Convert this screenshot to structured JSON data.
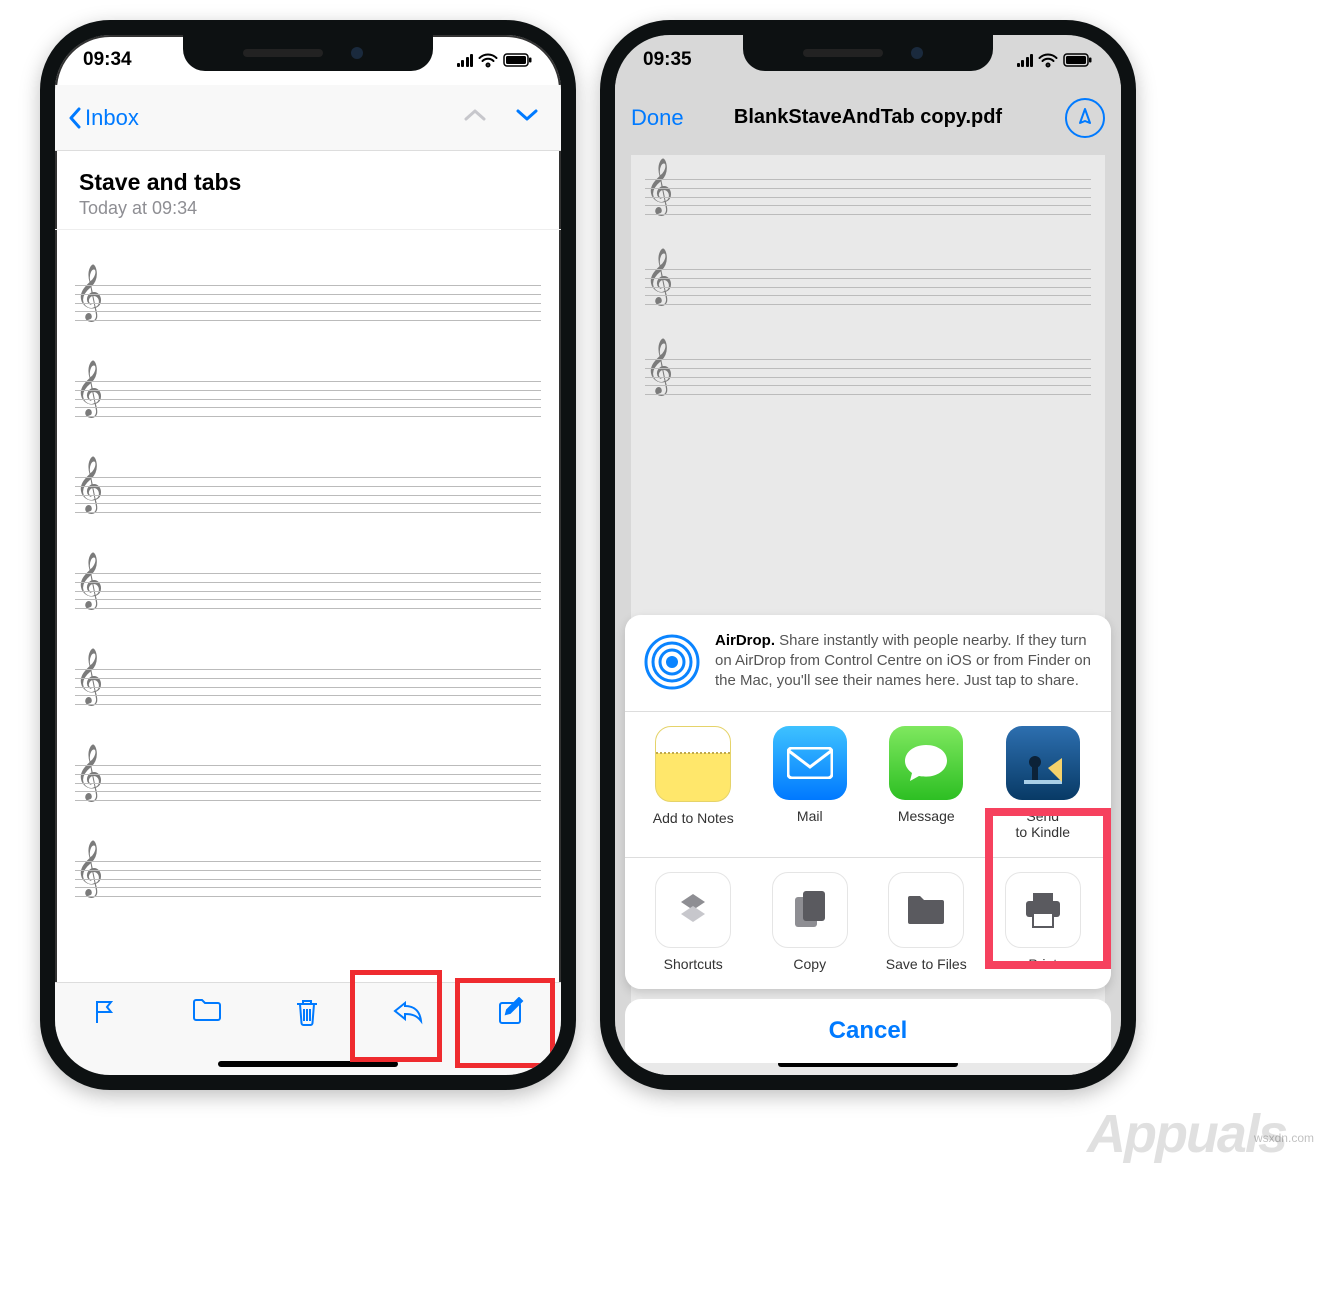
{
  "left": {
    "status": {
      "time": "09:34"
    },
    "nav": {
      "back": "Inbox"
    },
    "mail": {
      "subject": "Stave and tabs",
      "date": "Today at 09:34"
    }
  },
  "right": {
    "status": {
      "time": "09:35"
    },
    "nav": {
      "done": "Done",
      "title": "BlankStaveAndTab copy.pdf"
    },
    "airdrop": {
      "bold": "AirDrop.",
      "text": " Share instantly with people nearby. If they turn on AirDrop from Control Centre on iOS or from Finder on the Mac, you'll see their names here. Just tap to share."
    },
    "apps": {
      "notes": "Add to Notes",
      "mail": "Mail",
      "message": "Message",
      "kindle_l1": "Send",
      "kindle_l2": "to Kindle"
    },
    "actions": {
      "shortcuts": "Shortcuts",
      "copy": "Copy",
      "save": "Save to Files",
      "print": "Print"
    },
    "cancel": "Cancel"
  },
  "watermark": "Appuals",
  "wsxdn": "wsxdn.com"
}
